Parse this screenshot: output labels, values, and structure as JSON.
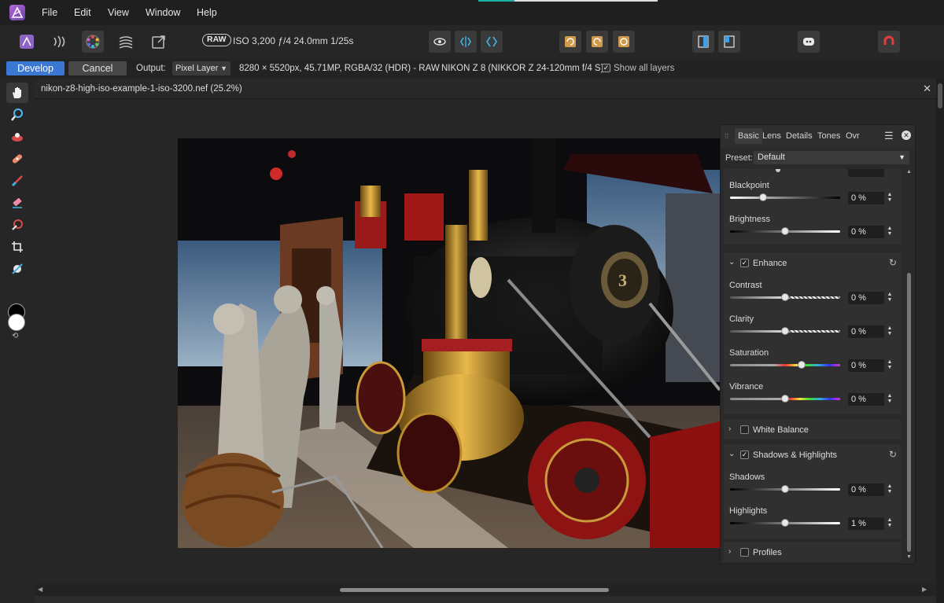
{
  "menubar": {
    "items": [
      "File",
      "Edit",
      "View",
      "Window",
      "Help"
    ]
  },
  "toolbar": {
    "raw_badge": "RAW",
    "exif": "ISO 3,200 ƒ/4 24.0mm 1/25s"
  },
  "contextbar": {
    "develop": "Develop",
    "cancel": "Cancel",
    "output_label": "Output:",
    "output_value": "Pixel Layer",
    "image_info": "8280 × 5520px, 45.71MP, RGBA/32 (HDR) - RAW",
    "camera": "NIKON Z 8 (NIKKOR Z 24-120mm f/4 S)",
    "show_all_layers": "Show all layers"
  },
  "document": {
    "title": "nikon-z8-high-iso-example-1-iso-3200.nef (25.2%)"
  },
  "panel": {
    "tabs": [
      "Basic",
      "Lens",
      "Details",
      "Tones",
      "Ovr"
    ],
    "preset_label": "Preset:",
    "preset_value": "Default",
    "basic": {
      "blackpoint": {
        "label": "Blackpoint",
        "value": "0 %",
        "level": 0.3
      },
      "brightness": {
        "label": "Brightness",
        "value": "0 %",
        "level": 0.5
      }
    },
    "enhance": {
      "title": "Enhance",
      "contrast": {
        "label": "Contrast",
        "value": "0 %",
        "level": 0.5
      },
      "clarity": {
        "label": "Clarity",
        "value": "0 %",
        "level": 0.5
      },
      "saturation": {
        "label": "Saturation",
        "value": "0 %",
        "level": 0.65
      },
      "vibrance": {
        "label": "Vibrance",
        "value": "0 %",
        "level": 0.5
      }
    },
    "white_balance": {
      "title": "White Balance"
    },
    "shadows_highlights": {
      "title": "Shadows & Highlights",
      "shadows": {
        "label": "Shadows",
        "value": "0 %",
        "level": 0.5
      },
      "highlights": {
        "label": "Highlights",
        "value": "1 %",
        "level": 0.5
      }
    },
    "profiles": {
      "title": "Profiles"
    }
  },
  "colors": {
    "accent": "#3a78d4",
    "teal": "#19b3a6"
  }
}
